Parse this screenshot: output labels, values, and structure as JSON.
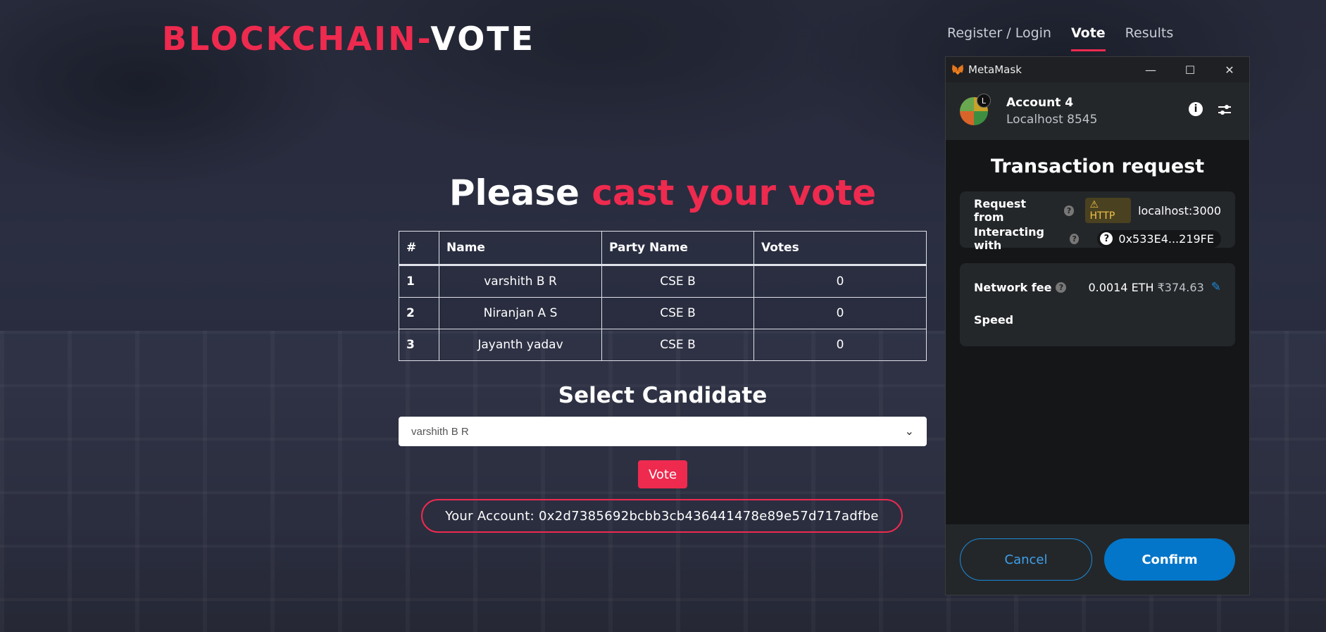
{
  "header": {
    "logo_part1": "BLOCKCHAIN-",
    "logo_part2": "VOTE",
    "nav": [
      {
        "label": "Register / Login",
        "active": false
      },
      {
        "label": "Vote",
        "active": true
      },
      {
        "label": "Results",
        "active": false
      }
    ]
  },
  "main": {
    "heading_white": "Please",
    "heading_red": "cast your vote",
    "table": {
      "headers": [
        "#",
        "Name",
        "Party Name",
        "Votes"
      ],
      "rows": [
        [
          "1",
          "varshith B R",
          "CSE B",
          "0"
        ],
        [
          "2",
          "Niranjan A S",
          "CSE B",
          "0"
        ],
        [
          "3",
          "Jayanth yadav",
          "CSE B",
          "0"
        ]
      ]
    },
    "select_title": "Select Candidate",
    "select_value": "varshith B R",
    "vote_button": "Vote",
    "account_label": "Your Account: 0x2d7385692bcbb3cb436441478e89e57d717adfbe"
  },
  "metamask": {
    "window_title": "MetaMask",
    "account_name": "Account 4",
    "network": "Localhost 8545",
    "avatar_badge": "L",
    "heading": "Transaction request",
    "request_from_label": "Request from",
    "http_badge": "HTTP",
    "request_from_host": "localhost:3000",
    "interacting_label": "Interacting with",
    "contract_address": "0x533E4...219FE",
    "network_fee_label": "Network fee",
    "fee_eth": "0.0014 ETH",
    "fee_fiat": "₹374.63",
    "speed_label": "Speed",
    "cancel": "Cancel",
    "confirm": "Confirm"
  },
  "colors": {
    "accent_red": "#ee2a4f",
    "metamask_blue": "#0376c9"
  }
}
